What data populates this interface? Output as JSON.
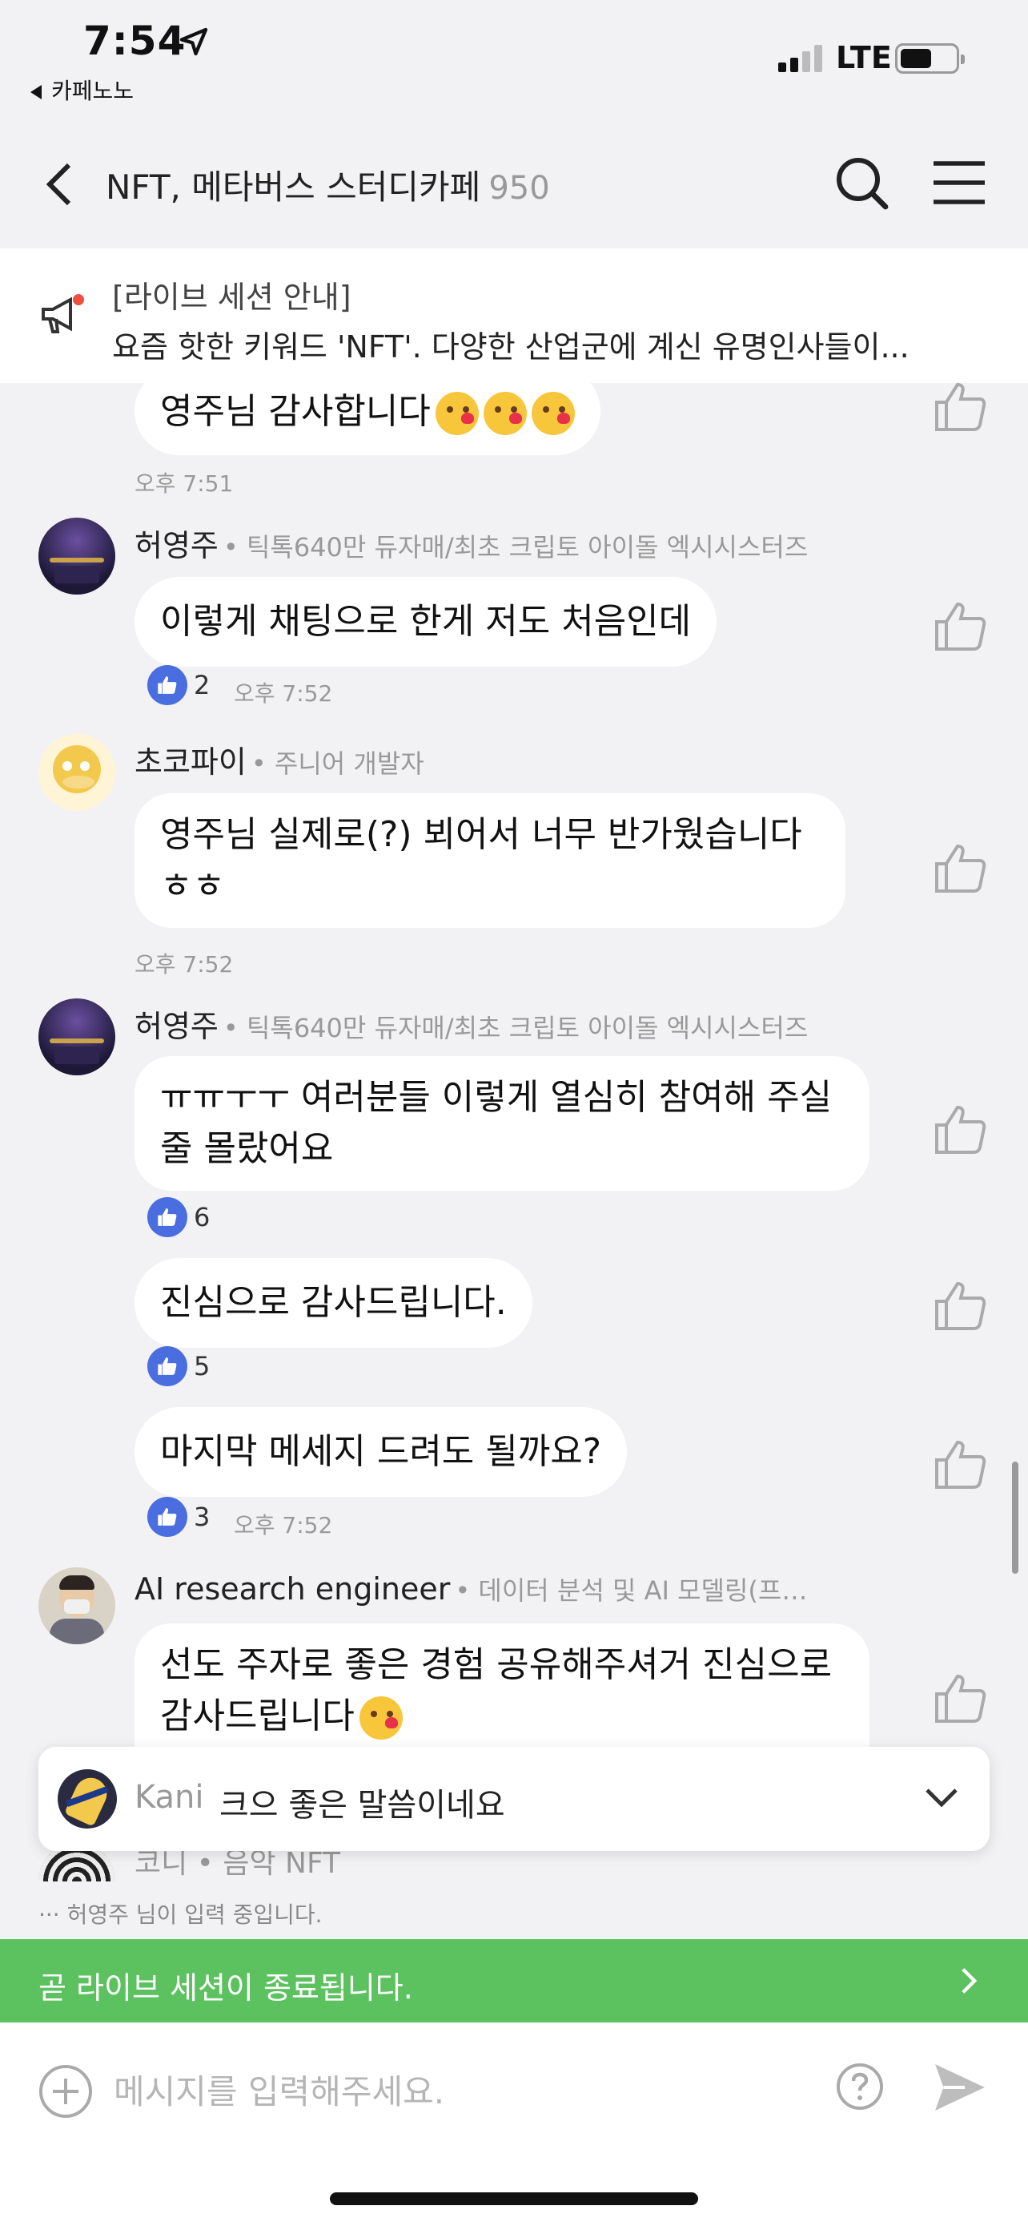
{
  "status": {
    "time": "7:54",
    "back_app": "카페노노",
    "network": "LTE"
  },
  "header": {
    "title": "NFT, 메타버스 스터디카페",
    "count": "950"
  },
  "notice": {
    "title": "[라이브 세션 안내]",
    "text": "요즘 핫한 키워드 'NFT'. 다양한 산업군에 계신 유명인사들이..."
  },
  "messages": {
    "m0": {
      "text": "영주님 감사합니다",
      "time": "오후 7:51"
    },
    "m1": {
      "sender": "허영주",
      "sender_sub": "• 틱톡640만 듀자매/최초 크립토 아이돌 엑시시스터즈",
      "text": "이렇게 채팅으로 한게 저도 처음인데",
      "likes": "2",
      "time": "오후 7:52"
    },
    "m2": {
      "sender": "초코파이",
      "sender_sub": "• 주니어 개발자",
      "line1": "영주님 실제로(?) 뵈어서 너무 반가웠습니다",
      "line2": "ㅎㅎ",
      "time": "오후 7:52"
    },
    "m3": {
      "sender": "허영주",
      "sender_sub": "• 틱톡640만 듀자매/최초 크립토 아이돌 엑시시스터즈",
      "line1": "ㅠㅠㅜㅜ 여러분들 이렇게 열심히 참여해 주실",
      "line2": "줄 몰랐어요",
      "likes": "6"
    },
    "m4": {
      "text": "진심으로 감사드립니다.",
      "likes": "5"
    },
    "m5": {
      "text": "마지막 메세지 드려도 될까요?",
      "likes": "3",
      "time": "오후 7:52"
    },
    "m6": {
      "sender": "AI research engineer",
      "sender_sub": "• 데이터 분석 및 AI 모델링(프…",
      "line1": "선도 주자로 좋은 경험 공유해주셔거 진심으로",
      "line2": "감사드립니다"
    }
  },
  "float_reply": {
    "name": "Kani",
    "text": "크으 좋은 말씀이네요"
  },
  "partial_sender": "코니 • 음악 NFT",
  "typing": "··· 허영주 님이 입력 중입니다.",
  "session_bar": {
    "text": "곧 라이브 세션이 종료됩니다."
  },
  "input": {
    "placeholder": "메시지를 입력해주세요."
  },
  "colors": {
    "accent": "#4a6ee0",
    "session": "#5cc25f",
    "background": "#f2f2f4"
  }
}
